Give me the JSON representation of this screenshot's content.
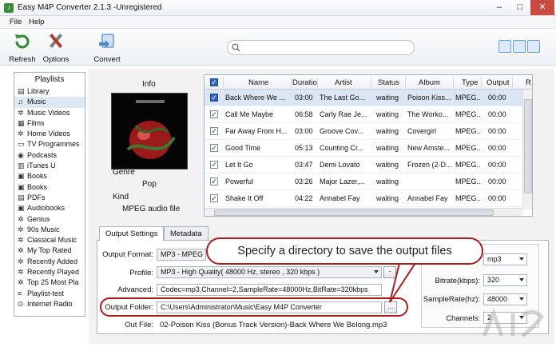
{
  "window": {
    "title": "Easy M4P Converter 2.1.3 -Unregistered"
  },
  "menu": {
    "items": [
      "File",
      "Help"
    ]
  },
  "toolbar": {
    "refresh": "Refresh",
    "options": "Options",
    "convert": "Convert",
    "search_placeholder": ""
  },
  "sidebar": {
    "header": "Playlists",
    "items": [
      {
        "label": "Library",
        "icon": "library-icon"
      },
      {
        "label": "Music",
        "icon": "music-note-icon",
        "selected": true
      },
      {
        "label": "Music Videos",
        "icon": "gear-icon"
      },
      {
        "label": "Films",
        "icon": "film-icon"
      },
      {
        "label": "Home Videos",
        "icon": "gear-icon"
      },
      {
        "label": "TV Programmes",
        "icon": "tv-icon"
      },
      {
        "label": "Podcasts",
        "icon": "podcast-icon"
      },
      {
        "label": "iTunes U",
        "icon": "itunes-u-icon"
      },
      {
        "label": "Books",
        "icon": "book-icon"
      },
      {
        "label": "Books",
        "icon": "book-icon"
      },
      {
        "label": "PDFs",
        "icon": "pdf-icon"
      },
      {
        "label": "Audiobooks",
        "icon": "book-icon"
      },
      {
        "label": "Genius",
        "icon": "gear-icon"
      },
      {
        "label": "90s Music",
        "icon": "gear-icon"
      },
      {
        "label": "Classical Music",
        "icon": "gear-icon"
      },
      {
        "label": "My Top Rated",
        "icon": "gear-icon"
      },
      {
        "label": "Recently Added",
        "icon": "gear-icon"
      },
      {
        "label": "Recently Played",
        "icon": "gear-icon"
      },
      {
        "label": "Top 25 Most Pla",
        "icon": "gear-icon"
      },
      {
        "label": "Playlist-test",
        "icon": "playlist-icon"
      },
      {
        "label": "Internet Radio",
        "icon": "radio-icon"
      }
    ]
  },
  "info": {
    "header": "Info",
    "genre_label": "Genre",
    "genre_value": "Pop",
    "kind_label": "Kind",
    "kind_value": "MPEG audio file"
  },
  "table": {
    "columns": [
      "Name",
      "Duration",
      "Artist",
      "Status",
      "Album",
      "Type",
      "Output",
      "R"
    ],
    "rows": [
      {
        "name": "Back Where We ...",
        "duration": "03:00",
        "artist": "The Last Go...",
        "status": "waiting",
        "album": "Poison Kiss...",
        "type": "MPEG...",
        "output": "00:00",
        "selected": true
      },
      {
        "name": "Call Me Maybe",
        "duration": "06:58",
        "artist": "Carly Rae Je...",
        "status": "waiting",
        "album": "The Worko...",
        "type": "MPEG...",
        "output": "00:00"
      },
      {
        "name": "Far Away From H...",
        "duration": "03:00",
        "artist": "Groove Cov...",
        "status": "waiting",
        "album": "Covergirl",
        "type": "MPEG...",
        "output": "00:00"
      },
      {
        "name": "Good Time",
        "duration": "05:13",
        "artist": "Counting Cr...",
        "status": "waiting",
        "album": "New Amste...",
        "type": "MPEG...",
        "output": "00:00"
      },
      {
        "name": "Let It Go",
        "duration": "03:47",
        "artist": "Demi Lovato",
        "status": "waiting",
        "album": "Frozen (2-D...",
        "type": "MPEG...",
        "output": "00:00"
      },
      {
        "name": "Powerful",
        "duration": "03:26",
        "artist": "Major Lazer,...",
        "status": "waiting",
        "album": "",
        "type": "MPEG...",
        "output": "00:00"
      },
      {
        "name": "Shake It Off",
        "duration": "04:22",
        "artist": "Annabel Fay",
        "status": "waiting",
        "album": "Annabel Fay",
        "type": "MPEG...",
        "output": "00:00"
      }
    ]
  },
  "tabs": {
    "output_settings": "Output Settings",
    "metadata": "Metadata"
  },
  "settings": {
    "output_format_label": "Output Format:",
    "output_format_value": "MP3 - MPEG",
    "profile_label": "Profile:",
    "profile_value": "MP3 - High Quality( 48000 Hz, stereo , 320 kbps )",
    "advanced_label": "Advanced:",
    "advanced_value": "Codec=mp3,Channel=2,SampleRate=48000Hz,BitRate=320kbps",
    "output_folder_label": "Output Folder:",
    "output_folder_value": "C:\\Users\\Administrator\\Music\\Easy M4P Converter",
    "browse_label": "...",
    "out_file_label": "Out File:",
    "out_file_value": "02-Poison Kiss (Bonus Track Version)-Back Where We Belong.mp3"
  },
  "codec": {
    "format_value": "mp3",
    "bitrate_label": "Bitrate(kbps):",
    "bitrate_value": "320",
    "samplerate_label": "SampleRate(hz):",
    "samplerate_value": "48000",
    "channels_label": "Channels:",
    "channels_value": "2"
  },
  "callout": {
    "text": "Specify a directory  to save the output files"
  },
  "colors": {
    "annotation_red": "#a81d1d",
    "selection_blue": "#dbe6f4"
  }
}
